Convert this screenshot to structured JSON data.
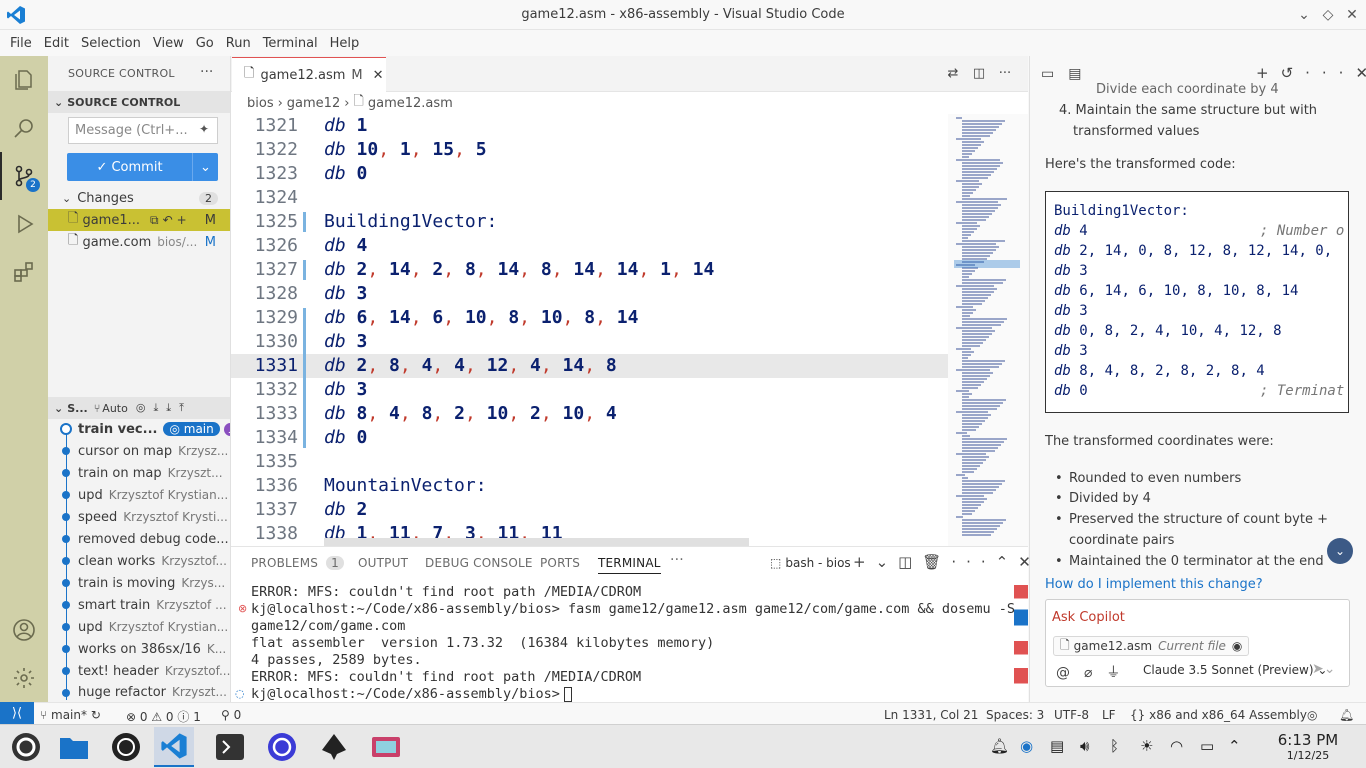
{
  "window": {
    "title": "game12.asm - x86-assembly - Visual Studio Code"
  },
  "menu": [
    "File",
    "Edit",
    "Selection",
    "View",
    "Go",
    "Run",
    "Terminal",
    "Help"
  ],
  "sidebar": {
    "header": "SOURCE CONTROL",
    "section": "SOURCE CONTROL",
    "message_placeholder": "Message (Ctrl+...",
    "commit_label": "✓ Commit",
    "changes_label": "Changes",
    "changes_count": "2",
    "badge": "2",
    "changes": [
      {
        "name": "game1...",
        "path": "",
        "status": "M"
      },
      {
        "name": "game.com",
        "path": "bios/...",
        "status": "M"
      }
    ],
    "graph_header": "S...",
    "graph_auto": "Auto",
    "graph": [
      {
        "message": "train vec...",
        "author": "",
        "branch": "main"
      },
      {
        "message": "cursor on map",
        "author": "Krzysz..."
      },
      {
        "message": "train on map",
        "author": "Krzyszt..."
      },
      {
        "message": "upd",
        "author": "Krzysztof Krystian..."
      },
      {
        "message": "speed",
        "author": "Krzysztof Krysti..."
      },
      {
        "message": "removed debug code...",
        "author": ""
      },
      {
        "message": "clean works",
        "author": "Krzysztof..."
      },
      {
        "message": "train is moving",
        "author": "Krzys..."
      },
      {
        "message": "smart train",
        "author": "Krzysztof ..."
      },
      {
        "message": "upd",
        "author": "Krzysztof Krystian..."
      },
      {
        "message": "works on 386sx/16",
        "author": "K..."
      },
      {
        "message": "text! header",
        "author": "Krzysztof..."
      },
      {
        "message": "huge refactor",
        "author": "Krzyszt..."
      }
    ]
  },
  "editor": {
    "tab": {
      "label": "game12.asm",
      "status": "M"
    },
    "breadcrumb": [
      "bios",
      "game12",
      "game12.asm"
    ],
    "lines": [
      {
        "n": "1321",
        "kind": "db",
        "values": "1"
      },
      {
        "n": "1322",
        "kind": "db",
        "values": "10, 1, 15, 5"
      },
      {
        "n": "1323",
        "kind": "db",
        "values": "0"
      },
      {
        "n": "1324",
        "kind": "blank",
        "values": ""
      },
      {
        "n": "1325",
        "kind": "label",
        "values": "Building1Vector:"
      },
      {
        "n": "1326",
        "kind": "db",
        "values": "4"
      },
      {
        "n": "1327",
        "kind": "db",
        "values": "2, 14, 2, 8, 14, 8, 14, 14, 1, 14"
      },
      {
        "n": "1328",
        "kind": "db",
        "values": "3"
      },
      {
        "n": "1329",
        "kind": "db",
        "values": "6, 14, 6, 10, 8, 10, 8, 14"
      },
      {
        "n": "1330",
        "kind": "db",
        "values": "3"
      },
      {
        "n": "1331",
        "kind": "db",
        "values": "2, 8, 4, 4, 12, 4, 14, 8",
        "current": true
      },
      {
        "n": "1332",
        "kind": "db",
        "values": "3"
      },
      {
        "n": "1333",
        "kind": "db",
        "values": "8, 4, 8, 2, 10, 2, 10, 4"
      },
      {
        "n": "1334",
        "kind": "db",
        "values": "0"
      },
      {
        "n": "1335",
        "kind": "blank",
        "values": ""
      },
      {
        "n": "1336",
        "kind": "label",
        "values": "MountainVector:"
      },
      {
        "n": "1337",
        "kind": "db",
        "values": "2"
      },
      {
        "n": "1338",
        "kind": "db",
        "values": "1, 11, 7, 3, 11, 11"
      }
    ]
  },
  "panel": {
    "tabs": [
      "PROBLEMS",
      "OUTPUT",
      "DEBUG CONSOLE",
      "PORTS",
      "TERMINAL"
    ],
    "problems_count": "1",
    "terminal_name": "bash - bios",
    "terminal_lines": [
      "ERROR: MFS: couldn't find root path /MEDIA/CDROM",
      "kj@localhost:~/Code/x86-assembly/bios> fasm game12/game12.asm game12/com/game.com && dosemu -S",
      "game12/com/game.com",
      "flat assembler  version 1.73.32  (16384 kilobytes memory)",
      "4 passes, 2589 bytes.",
      "ERROR: MFS: couldn't find root path /MEDIA/CDROM",
      "kj@localhost:~/Code/x86-assembly/bios> "
    ]
  },
  "chat": {
    "top_partial": "Divide each coordinate by 4",
    "step4": "4.  Maintain the same structure but with",
    "step4b": "transformed values",
    "intro": "Here's the transformed code:",
    "code": [
      {
        "kw": "",
        "vals": "Building1Vector:",
        "comment": ""
      },
      {
        "kw": "db",
        "vals": "4",
        "comment": "; Number o"
      },
      {
        "kw": "db",
        "vals": "2, 14, 0, 8, 12, 8, 12, 14, 0,",
        "comment": ""
      },
      {
        "kw": "db",
        "vals": "3",
        "comment": ""
      },
      {
        "kw": "db",
        "vals": "6, 14, 6, 10, 8, 10, 8, 14",
        "comment": ""
      },
      {
        "kw": "db",
        "vals": "3",
        "comment": ""
      },
      {
        "kw": "db",
        "vals": "0, 8, 2, 4, 10, 4, 12, 8",
        "comment": ""
      },
      {
        "kw": "db",
        "vals": "3",
        "comment": ""
      },
      {
        "kw": "db",
        "vals": "8, 4, 8, 2, 8, 2, 8, 4",
        "comment": ""
      },
      {
        "kw": "db",
        "vals": "0",
        "comment": "; Terminat"
      }
    ],
    "summary": "The transformed coordinates were:",
    "bullets": [
      "Rounded to even numbers",
      "Divided by 4",
      "Preserved the structure of count byte +",
      "coordinate pairs",
      "Maintained the 0 terminator at the end"
    ],
    "followup": "How do I implement this change?",
    "ask_placeholder": "Ask Copilot",
    "context_file": "game12.asm",
    "context_label": "Current file",
    "model": "Claude 3.5 Sonnet (Preview)"
  },
  "statusbar": {
    "branch": "main*",
    "errors": "0",
    "warnings": "0",
    "info": "1",
    "ports": "0",
    "position": "Ln 1331, Col 21",
    "spaces": "Spaces: 3",
    "encoding": "UTF-8",
    "eol": "LF",
    "language": "x86 and x86_64 Assembly"
  },
  "taskbar": {
    "time": "6:13 PM",
    "date": "1/12/25"
  },
  "colors": {
    "accent": "#3a8ee6",
    "activity_bar": "#d0d0a8",
    "selected_change": "#c9c133"
  }
}
